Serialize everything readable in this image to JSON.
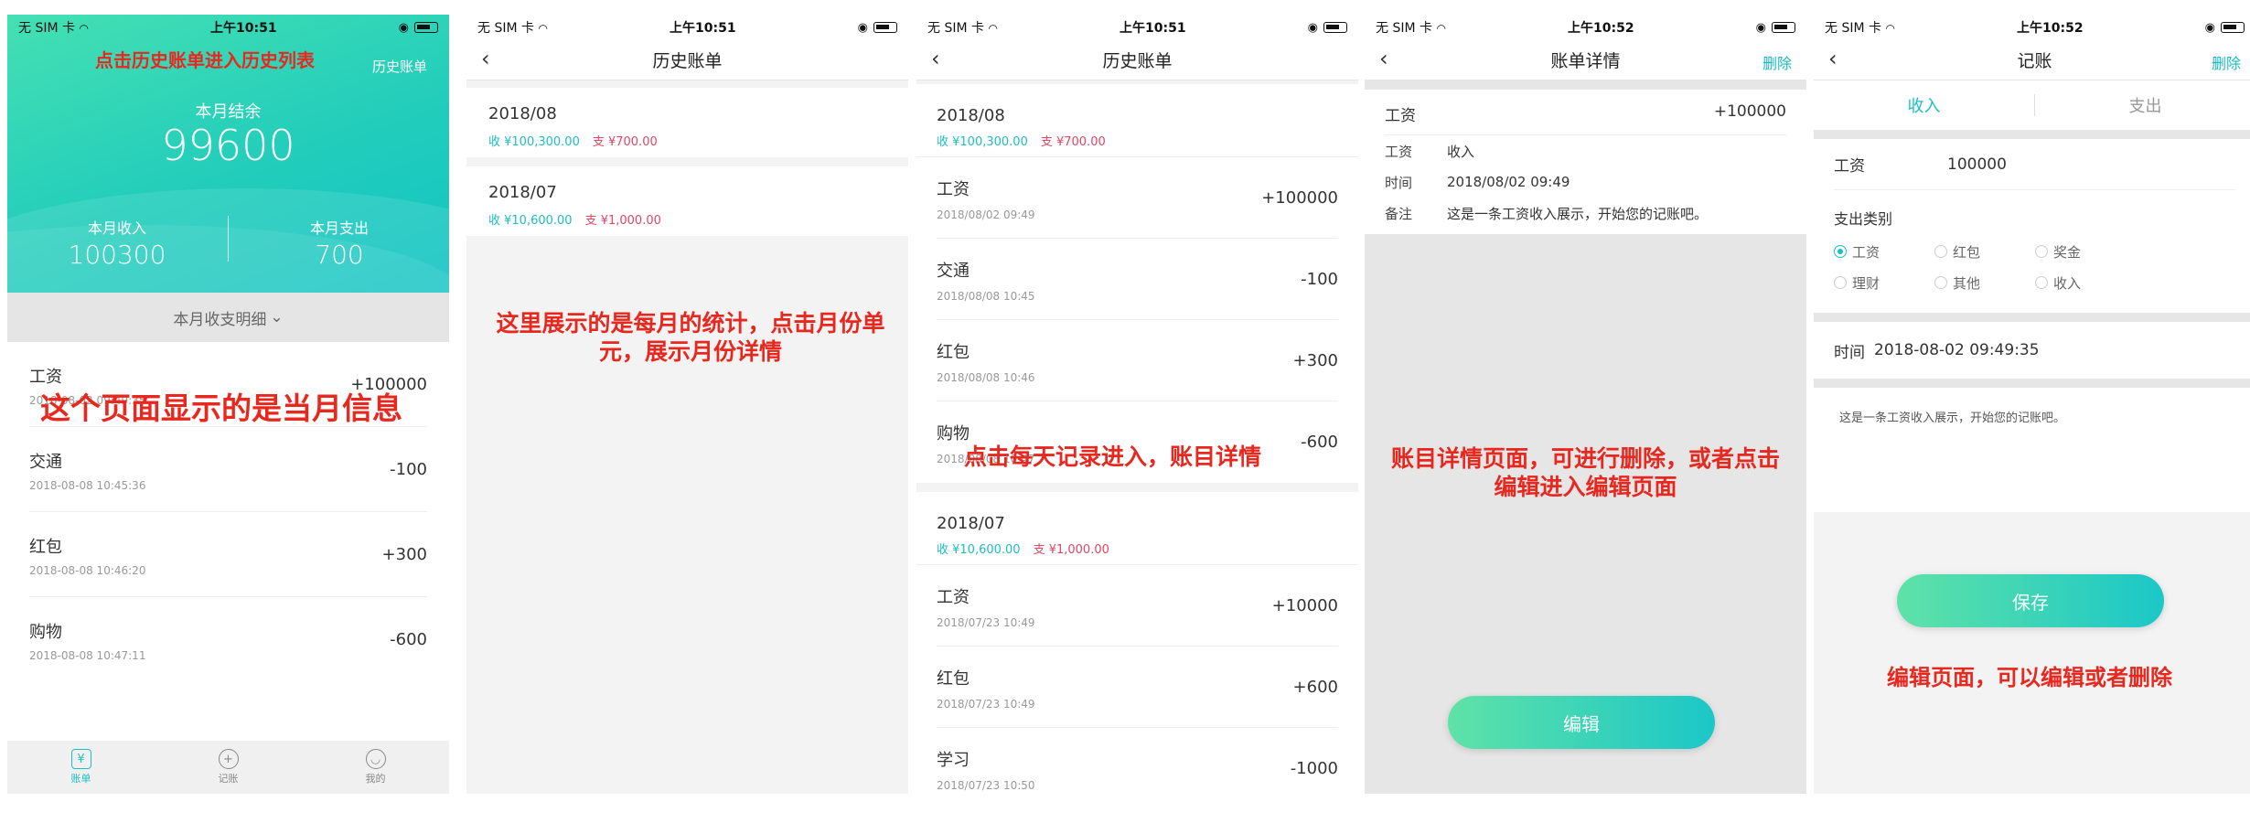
{
  "status": {
    "carrier": "无 SIM 卡",
    "times": [
      "上午10:51",
      "上午10:51",
      "上午10:51",
      "上午10:52",
      "上午10:52"
    ]
  },
  "screen1": {
    "history_link": "历史账单",
    "balance_label": "本月结余",
    "balance_value": "99600",
    "income_label": "本月收入",
    "income_value": "100300",
    "expense_label": "本月支出",
    "expense_value": "700",
    "detail_toggle": "本月收支明细",
    "items": [
      {
        "name": "工资",
        "time": "2018-08-02 09:49:35",
        "amount": "+100000"
      },
      {
        "name": "交通",
        "time": "2018-08-08 10:45:36",
        "amount": "-100"
      },
      {
        "name": "红包",
        "time": "2018-08-08 10:46:20",
        "amount": "+300"
      },
      {
        "name": "购物",
        "time": "2018-08-08 10:47:11",
        "amount": "-600"
      }
    ],
    "tabs": [
      "账单",
      "记账",
      "我的"
    ],
    "annotation_top": "点击历史账单进入历史列表",
    "annotation_mid": "这个页面显示的是当月信息"
  },
  "screen2": {
    "title": "历史账单",
    "months": [
      {
        "month": "2018/08",
        "income": "收 ¥100,300.00",
        "expense": "支 ¥700.00"
      },
      {
        "month": "2018/07",
        "income": "收 ¥10,600.00",
        "expense": "支 ¥1,000.00"
      }
    ],
    "annotation": "这里展示的是每月的统计，点击月份单元，展示月份详情"
  },
  "screen3": {
    "title": "历史账单",
    "sections": [
      {
        "month": "2018/08",
        "income": "收 ¥100,300.00",
        "expense": "支 ¥700.00",
        "items": [
          {
            "name": "工资",
            "time": "2018/08/02 09:49",
            "amount": "+100000"
          },
          {
            "name": "交通",
            "time": "2018/08/08 10:45",
            "amount": "-100"
          },
          {
            "name": "红包",
            "time": "2018/08/08 10:46",
            "amount": "+300"
          },
          {
            "name": "购物",
            "time": "2018/08/08 10:47",
            "amount": "-600"
          }
        ]
      },
      {
        "month": "2018/07",
        "income": "收 ¥10,600.00",
        "expense": "支 ¥1,000.00",
        "items": [
          {
            "name": "工资",
            "time": "2018/07/23 10:49",
            "amount": "+10000"
          },
          {
            "name": "红包",
            "time": "2018/07/23 10:49",
            "amount": "+600"
          },
          {
            "name": "学习",
            "time": "2018/07/23 10:50",
            "amount": "-1000"
          }
        ]
      }
    ],
    "annotation": "点击每天记录进入，账目详情"
  },
  "screen4": {
    "title": "账单详情",
    "action": "删除",
    "head_name": "工资",
    "head_amount": "+100000",
    "rows": [
      {
        "k": "工资",
        "v": "收入"
      },
      {
        "k": "时间",
        "v": "2018/08/02 09:49"
      },
      {
        "k": "备注",
        "v": "这是一条工资收入展示，开始您的记账吧。"
      }
    ],
    "edit_button": "编辑",
    "annotation": "账目详情页面，可进行删除，或者点击编辑进入编辑页面"
  },
  "screen5": {
    "title": "记账",
    "action": "删除",
    "seg_income": "收入",
    "seg_expense": "支出",
    "field_name": "工资",
    "field_value": "100000",
    "category_title": "支出类别",
    "categories": [
      {
        "label": "工资",
        "selected": true
      },
      {
        "label": "红包",
        "selected": false
      },
      {
        "label": "奖金",
        "selected": false
      },
      {
        "label": "理财",
        "selected": false
      },
      {
        "label": "其他",
        "selected": false
      },
      {
        "label": "收入",
        "selected": false
      }
    ],
    "time_label": "时间",
    "time_value": "2018-08-02 09:49:35",
    "note": "这是一条工资收入展示，开始您的记账吧。",
    "save_button": "保存",
    "annotation": "编辑页面，可以编辑或者删除"
  },
  "colors": {
    "accent": "#1bbfc3",
    "gradient_start": "#45e0b3",
    "gradient_end": "#13c4c4",
    "expense": "#e24663",
    "annotation": "#e8281f"
  }
}
